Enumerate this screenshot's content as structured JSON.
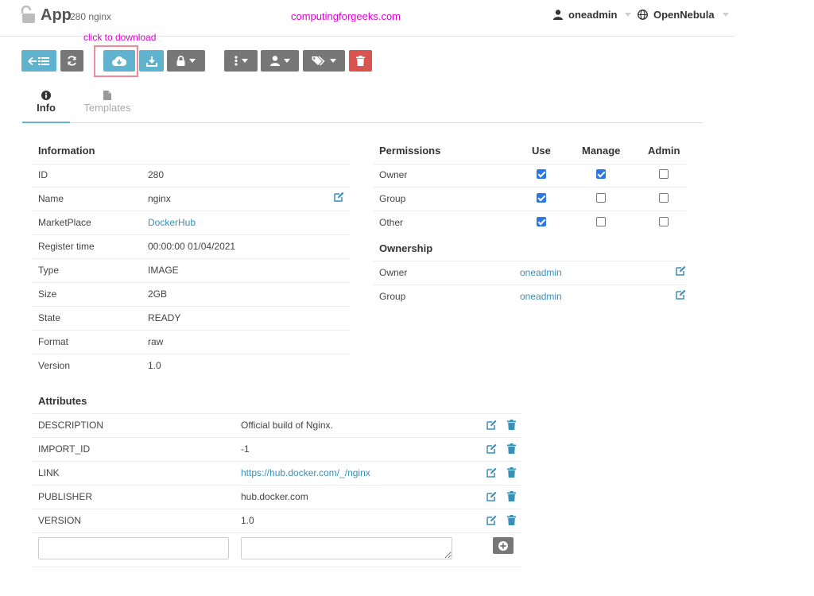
{
  "header": {
    "title": "App",
    "subtitle": "280 nginx",
    "watermark": "computingforgeeks.com",
    "user": "oneadmin",
    "zone": "OpenNebula"
  },
  "annotation": {
    "text": "click to download"
  },
  "tabs": [
    {
      "label": "Info",
      "icon": "info-circle-icon",
      "active": true
    },
    {
      "label": "Templates",
      "icon": "file-icon",
      "active": false
    }
  ],
  "information": {
    "title": "Information",
    "rows": [
      {
        "label": "ID",
        "value": "280"
      },
      {
        "label": "Name",
        "value": "nginx"
      },
      {
        "label": "MarketPlace",
        "value": "DockerHub"
      },
      {
        "label": "Register time",
        "value": "00:00:00 01/04/2021"
      },
      {
        "label": "Type",
        "value": "IMAGE"
      },
      {
        "label": "Size",
        "value": "2GB"
      },
      {
        "label": "State",
        "value": "READY"
      },
      {
        "label": "Format",
        "value": "raw"
      },
      {
        "label": "Version",
        "value": "1.0"
      }
    ]
  },
  "permissions": {
    "title": "Permissions",
    "columns": [
      "Use",
      "Manage",
      "Admin"
    ],
    "rows": [
      {
        "label": "Owner",
        "use": true,
        "manage": true,
        "admin": false
      },
      {
        "label": "Group",
        "use": true,
        "manage": false,
        "admin": false
      },
      {
        "label": "Other",
        "use": true,
        "manage": false,
        "admin": false
      }
    ]
  },
  "ownership": {
    "title": "Ownership",
    "rows": [
      {
        "label": "Owner",
        "value": "oneadmin"
      },
      {
        "label": "Group",
        "value": "oneadmin"
      }
    ]
  },
  "attributes": {
    "title": "Attributes",
    "rows": [
      {
        "key": "DESCRIPTION",
        "value": "Official build of Nginx."
      },
      {
        "key": "IMPORT_ID",
        "value": "-1"
      },
      {
        "key": "LINK",
        "value": "https://hub.docker.com/_/nginx"
      },
      {
        "key": "PUBLISHER",
        "value": "hub.docker.com"
      },
      {
        "key": "VERSION",
        "value": "1.0"
      }
    ]
  },
  "colors": {
    "accent": "#5fb3ce",
    "danger": "#d9534f",
    "neutral": "#777777",
    "link": "#3a8fb7",
    "annotation": "#e000d2"
  }
}
